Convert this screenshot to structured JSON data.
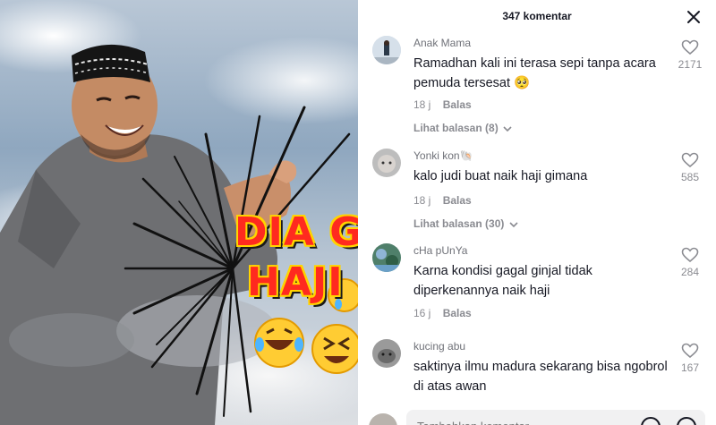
{
  "video": {
    "caption_line1": "DIA GAGA",
    "caption_line2": "HAJI"
  },
  "panel": {
    "title": "347 komentar",
    "comments": [
      {
        "username": "Anak Mama",
        "text": "Ramadhan kali ini terasa sepi tanpa acara pemuda tersesat 🥺",
        "time": "18 j",
        "reply_label": "Balas",
        "likes": "2171",
        "replies_label": "Lihat balasan (8)"
      },
      {
        "username": "Yonki kon🐚",
        "text": "kalo judi buat naik haji gimana",
        "time": "18 j",
        "reply_label": "Balas",
        "likes": "585",
        "replies_label": "Lihat balasan (30)"
      },
      {
        "username": "cHa pUnYa",
        "text": "Karna kondisi gagal ginjal tidak diperkenannya naik haji",
        "time": "16 j",
        "reply_label": "Balas",
        "likes": "284"
      },
      {
        "username": "kucing abu",
        "text": "saktinya ilmu madura sekarang bisa ngobrol di atas awan",
        "likes": "167"
      }
    ],
    "input_placeholder": "Tambahkan komentar..."
  },
  "colors": {
    "text_primary": "#161823",
    "text_secondary": "#8a8b91",
    "caption_red": "#ff2a1f",
    "caption_outline": "#ffd400"
  }
}
